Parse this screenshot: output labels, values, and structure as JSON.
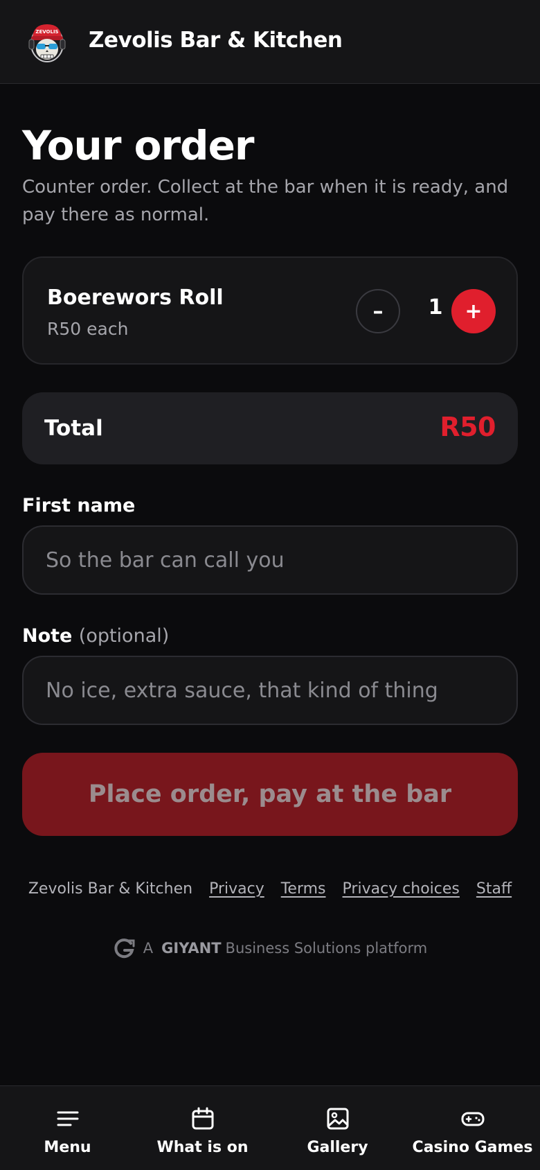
{
  "header": {
    "logo_text": "ZEVOLIS",
    "brand_name": "Zevolis Bar & Kitchen"
  },
  "main": {
    "title": "Your order",
    "subtitle": "Counter order. Collect at the bar when it is ready, and pay there as normal."
  },
  "order_item": {
    "name": "Boerewors Roll",
    "price": "R50 each",
    "quantity": "1",
    "minus_label": "–",
    "plus_label": "+"
  },
  "total": {
    "label": "Total",
    "value": "R50"
  },
  "form": {
    "first_name_label": "First name",
    "first_name_placeholder": "So the bar can call you",
    "first_name_value": "",
    "note_label": "Note",
    "note_optional": "(optional)",
    "note_placeholder": "No ice, extra sauce, that kind of thing",
    "note_value": ""
  },
  "submit": {
    "label": "Place order, pay at the bar"
  },
  "footer": {
    "business_name": "Zevolis Bar & Kitchen",
    "links": [
      "Privacy",
      "Terms",
      "Privacy choices",
      "Staff"
    ],
    "powered_prefix": "A",
    "powered_brand": "GIYANT",
    "powered_suffix": "Business Solutions platform"
  },
  "bottom_nav": {
    "items": [
      {
        "label": "Menu",
        "icon": "menu-lines-icon"
      },
      {
        "label": "What is on",
        "icon": "calendar-icon"
      },
      {
        "label": "Gallery",
        "icon": "image-icon"
      },
      {
        "label": "Casino Games",
        "icon": "gamepad-icon"
      }
    ]
  },
  "colors": {
    "background": "#0b0b0d",
    "accent": "#e01f2d",
    "submit_bg": "#78161c",
    "muted_text": "#a6a6ac"
  }
}
